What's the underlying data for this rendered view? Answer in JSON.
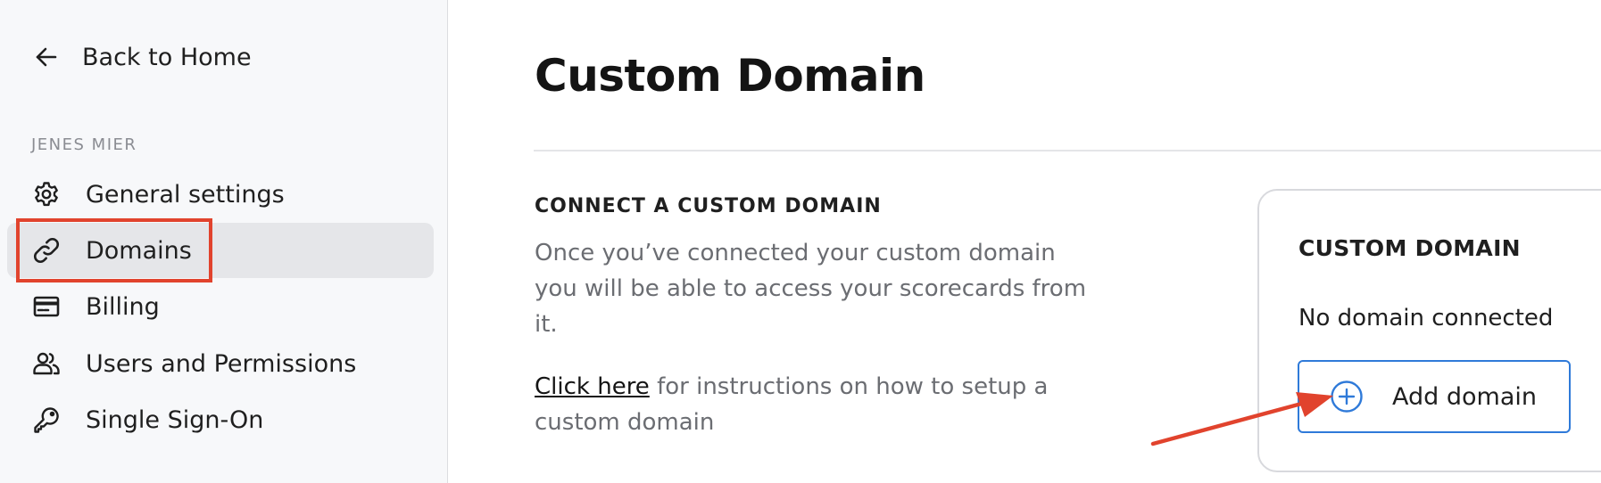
{
  "sidebar": {
    "back_label": "Back to Home",
    "workspace_label": "JENES MIER",
    "items": [
      {
        "label": "General settings",
        "icon": "gear-icon",
        "active": false
      },
      {
        "label": "Domains",
        "icon": "link-icon",
        "active": true
      },
      {
        "label": "Billing",
        "icon": "credit-card-icon",
        "active": false
      },
      {
        "label": "Users and Permissions",
        "icon": "users-icon",
        "active": false
      },
      {
        "label": "Single Sign-On",
        "icon": "key-icon",
        "active": false
      }
    ]
  },
  "main": {
    "title": "Custom Domain",
    "section_heading": "CONNECT A CUSTOM DOMAIN",
    "section_description": "Once you’ve connected your custom domain you will be able to access your scorecards from it.",
    "help_link_label": "Click here",
    "help_text": " for instructions on how to setup a custom domain"
  },
  "card": {
    "title": "CUSTOM DOMAIN",
    "status": "No domain connected",
    "add_button_label": "Add domain",
    "add_button_icon": "plus-circle-icon"
  },
  "colors": {
    "annotation_red": "#e1432d",
    "accent_blue": "#2f7ad9",
    "sidebar_bg": "#f7f8fa",
    "active_item_bg": "#e5e6e9"
  }
}
